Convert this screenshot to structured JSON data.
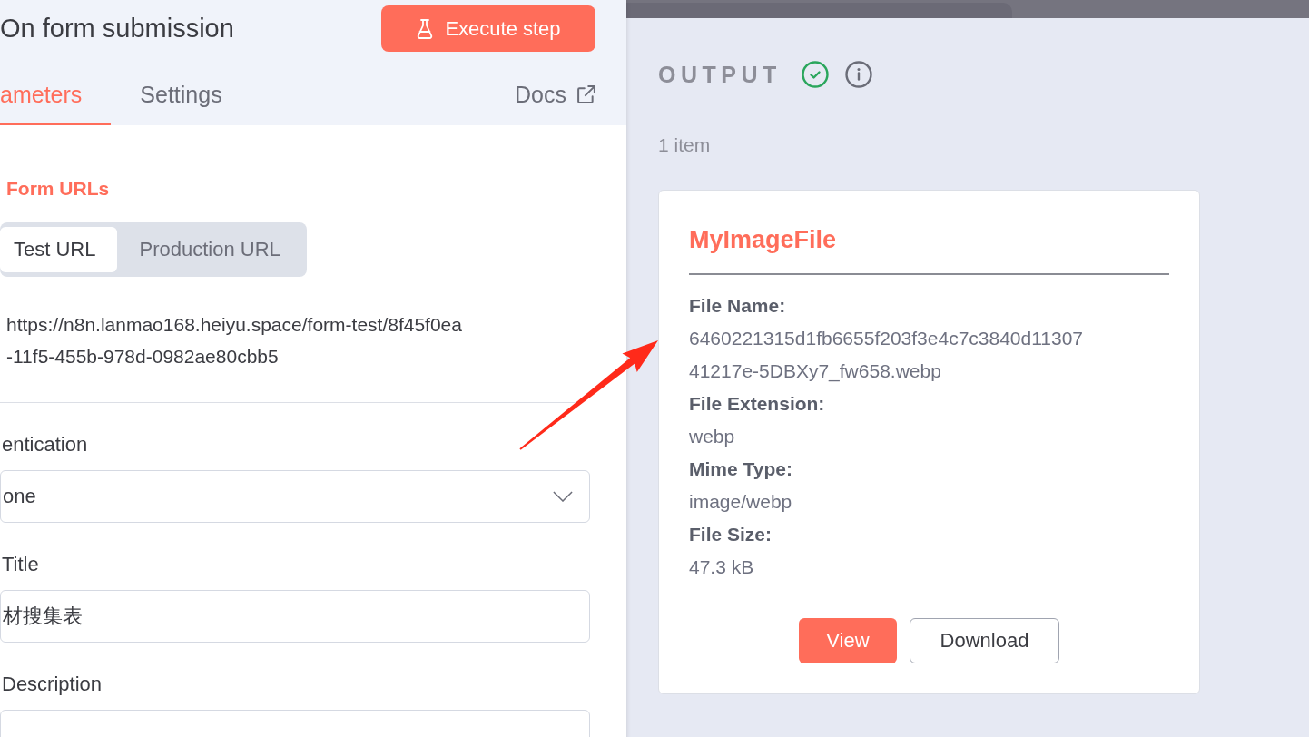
{
  "node_panel": {
    "title": "On form submission",
    "execute_button": {
      "label": "Execute step"
    },
    "tabs": [
      {
        "label": "ameters",
        "selected": true
      },
      {
        "label": "Settings",
        "selected": false
      }
    ],
    "docs_link": {
      "label": "Docs"
    },
    "form_urls": {
      "heading": "Form URLs",
      "url_types": [
        {
          "label": "Test URL",
          "selected": true
        },
        {
          "label": "Production URL",
          "selected": false
        }
      ],
      "url_lines": [
        "https://n8n.lanmao168.heiyu.space/form-test/8f45f0ea",
        "-11f5-455b-978d-0982ae80cbb5"
      ]
    },
    "fields": [
      {
        "kind": "dropdown",
        "label": "entication",
        "value": "one"
      },
      {
        "kind": "text",
        "label": "Title",
        "value": "材搜集表"
      },
      {
        "kind": "text",
        "label": "Description"
      }
    ]
  },
  "output_panel": {
    "heading": "OUTPUT",
    "success": true,
    "item_count": "1 item",
    "file_card": {
      "title": "MyImageFile",
      "rows": [
        {
          "label": "File Name:",
          "value_lines": [
            "6460221315d1fb6655f203f3e4c7c3840d11307",
            "41217e-5DBXy7_fw658.webp"
          ]
        },
        {
          "label": "File Extension:",
          "value_lines": [
            "webp"
          ]
        },
        {
          "label": "Mime Type:",
          "value_lines": [
            "image/webp"
          ]
        },
        {
          "label": "File Size:",
          "value_lines": [
            "47.3 kB"
          ]
        }
      ],
      "buttons": [
        {
          "label": "View",
          "kind": "primary"
        },
        {
          "label": "Download",
          "kind": "secondary"
        }
      ]
    }
  },
  "annotation": {
    "kind": "arrow"
  }
}
